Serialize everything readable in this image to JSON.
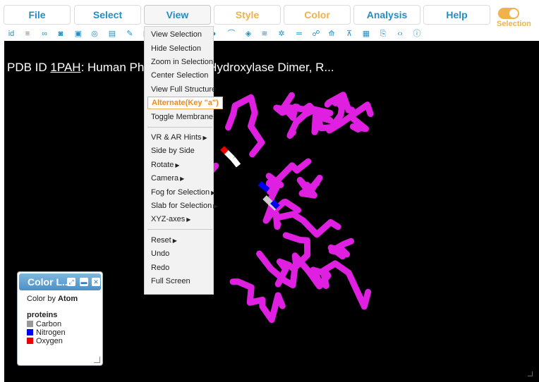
{
  "menu": [
    {
      "label": "File",
      "state": "normal"
    },
    {
      "label": "Select",
      "state": "normal"
    },
    {
      "label": "View",
      "state": "active"
    },
    {
      "label": "Style",
      "state": "inactive"
    },
    {
      "label": "Color",
      "state": "inactive"
    },
    {
      "label": "Analysis",
      "state": "normal"
    },
    {
      "label": "Help",
      "state": "normal"
    }
  ],
  "selection_toggle": {
    "label": "Selection",
    "on": true,
    "color": "#f0b24a"
  },
  "toolbar_icons": [
    "id-icon",
    "file-icon",
    "link-icon",
    "camera-icon",
    "select-box-icon",
    "target-icon",
    "save-icon",
    "pencil-icon",
    "view-icon",
    "hourglass-icon",
    "globe-icon",
    "cloud-icon",
    "contrast-icon",
    "rainbow-icon",
    "pill-icon",
    "layers-icon",
    "gear-atom-icon",
    "minus-icon",
    "network-icon",
    "download-cloud-icon",
    "compass-icon",
    "image-icon",
    "export-file-icon",
    "code-icon",
    "info-icon"
  ],
  "toolbar_icon_glyphs": [
    "id",
    "≡",
    "∞",
    "◙",
    "▣",
    "◎",
    "▤",
    "✎",
    "◱",
    "⧖",
    "◉",
    "☁",
    "◑",
    "⌒",
    "◈",
    "≋",
    "✲",
    "═",
    "☍",
    "⟰",
    "⊼",
    "▦",
    "⎘",
    "‹›",
    "ⓘ"
  ],
  "viewer": {
    "title_prefix": "PDB ID ",
    "pdb_id": "1PAH",
    "title_rest": ": Human Phenylalanine Hydroxylase Dimer, R..."
  },
  "view_menu": {
    "items": [
      {
        "label": "View Selection"
      },
      {
        "label": "Hide Selection"
      },
      {
        "label": "Zoom in Selection"
      },
      {
        "label": "Center Selection"
      },
      {
        "label": "View Full Structure"
      },
      {
        "label": "Alternate(Key \"a\")",
        "highlight": true
      },
      {
        "label": "Toggle Membrane"
      },
      {
        "label": "VR & AR Hints",
        "sub": true
      },
      {
        "label": "Side by Side"
      },
      {
        "label": "Rotate",
        "sub": true
      },
      {
        "label": "Camera",
        "sub": true
      },
      {
        "label": "Fog for Selection",
        "sub": true
      },
      {
        "label": "Slab for Selection",
        "sub": true
      },
      {
        "label": "XYZ-axes",
        "sub": true
      },
      {
        "label": "Reset",
        "sub": true
      },
      {
        "label": "Undo"
      },
      {
        "label": "Redo"
      },
      {
        "label": "Full Screen"
      }
    ]
  },
  "legend": {
    "title": "Color L...",
    "subtitle_prefix": "Color by ",
    "subtitle_value": "Atom",
    "group": "proteins",
    "entries": [
      {
        "label": "Carbon",
        "color": "#999999"
      },
      {
        "label": "Nitrogen",
        "color": "#0000ee"
      },
      {
        "label": "Oxygen",
        "color": "#ee0000"
      }
    ]
  },
  "colors": {
    "accent": "#1f8fc4",
    "inactive": "#f0b24a",
    "protein": "#e020e0",
    "background": "#000000"
  }
}
